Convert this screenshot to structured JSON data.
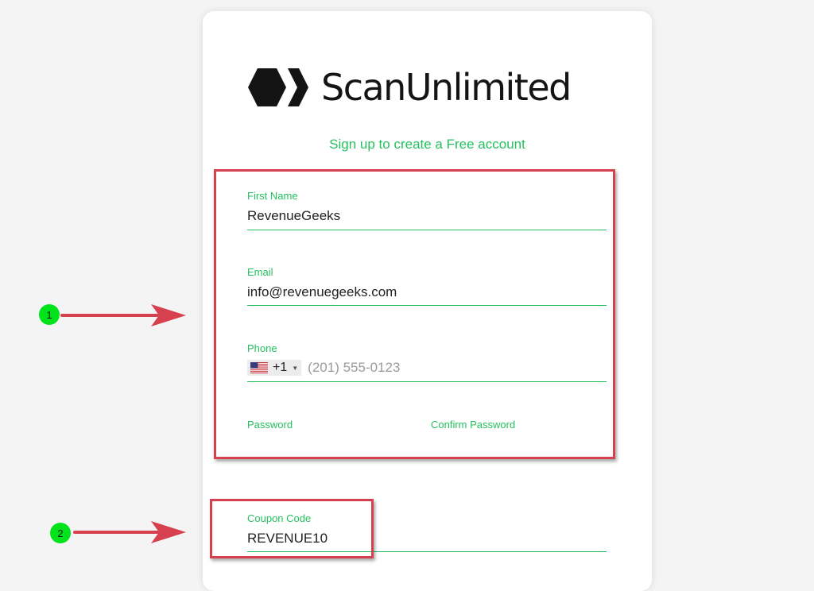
{
  "brand": {
    "name": "ScanUnlimited"
  },
  "signup": {
    "subtitle": "Sign up to create a Free account"
  },
  "form": {
    "first_name": {
      "label": "First Name",
      "value": "RevenueGeeks"
    },
    "email": {
      "label": "Email",
      "value": "info@revenuegeeks.com"
    },
    "phone": {
      "label": "Phone",
      "country_code": "+1",
      "placeholder": "(201) 555-0123",
      "country_flag": "us-flag-icon"
    },
    "password": {
      "label": "Password"
    },
    "confirm_password": {
      "label": "Confirm Password"
    },
    "coupon": {
      "label": "Coupon Code",
      "value": "REVENUE10"
    }
  },
  "annotations": {
    "badge_1": "1",
    "badge_2": "2"
  },
  "colors": {
    "accent": "#25c05f",
    "annotation_red": "#d7404f",
    "badge_green": "#00e31b"
  }
}
